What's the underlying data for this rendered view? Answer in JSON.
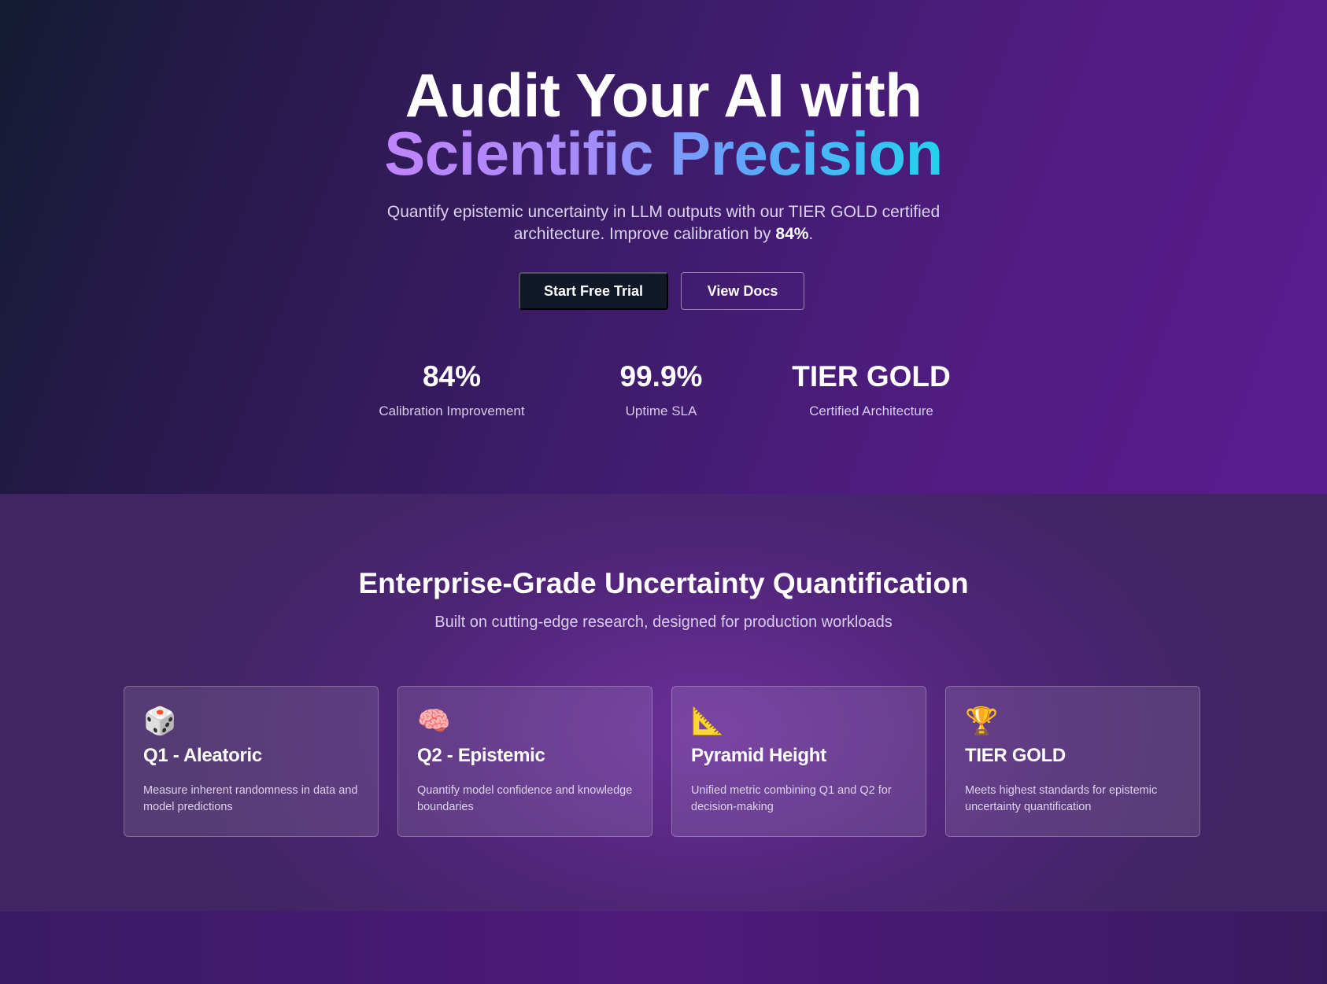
{
  "hero": {
    "title_line1": "Audit Your AI with",
    "title_line2": "Scientific Precision",
    "subtitle_part1": "Quantify epistemic uncertainty in LLM outputs with our TIER GOLD certified architecture. Improve calibration by ",
    "subtitle_bold": "84%",
    "subtitle_part2": ".",
    "primary_button": "Start Free Trial",
    "secondary_button": "View Docs",
    "stats": [
      {
        "value": "84%",
        "label": "Calibration Improvement"
      },
      {
        "value": "99.9%",
        "label": "Uptime SLA"
      },
      {
        "value": "TIER GOLD",
        "label": "Certified Architecture"
      }
    ]
  },
  "features": {
    "title": "Enterprise-Grade Uncertainty Quantification",
    "subtitle": "Built on cutting-edge research, designed for production workloads",
    "cards": [
      {
        "icon": "🎲",
        "icon_name": "dice-icon",
        "title": "Q1 - Aleatoric",
        "description": "Measure inherent randomness in data and model predictions"
      },
      {
        "icon": "🧠",
        "icon_name": "brain-icon",
        "title": "Q2 - Epistemic",
        "description": "Quantify model confidence and knowledge boundaries"
      },
      {
        "icon": "📐",
        "icon_name": "triangular-ruler-icon",
        "title": "Pyramid Height",
        "description": "Unified metric combining Q1 and Q2 for decision-making"
      },
      {
        "icon": "🏆",
        "icon_name": "trophy-icon",
        "title": "TIER GOLD",
        "description": "Meets highest standards for epistemic uncertainty quantification"
      }
    ]
  }
}
